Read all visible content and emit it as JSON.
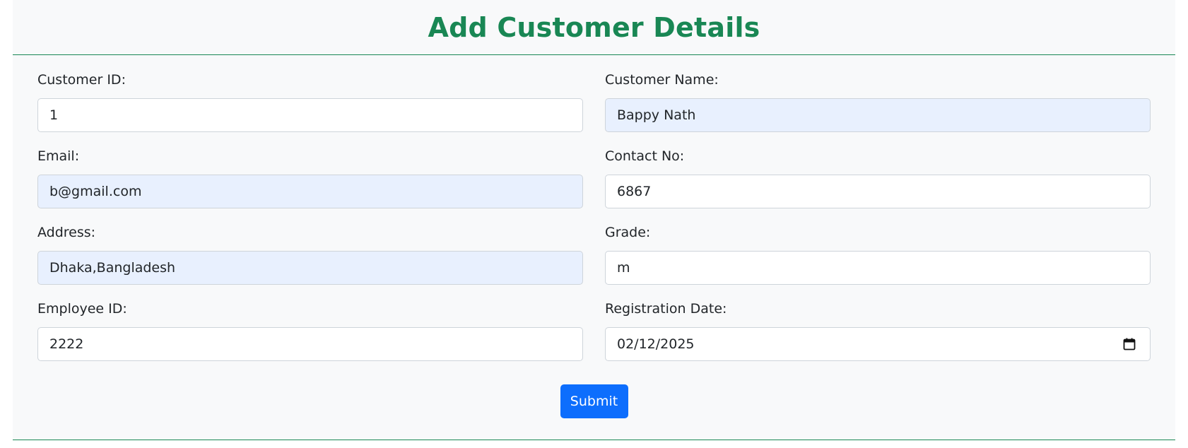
{
  "page": {
    "title": "Add Customer Details"
  },
  "form": {
    "customer_id": {
      "label": "Customer ID:",
      "value": "1"
    },
    "customer_name": {
      "label": "Customer Name:",
      "value": "Bappy Nath"
    },
    "email": {
      "label": "Email:",
      "value": "b@gmail.com"
    },
    "contact_no": {
      "label": "Contact No:",
      "value": "6867"
    },
    "address": {
      "label": "Address:",
      "value": "Dhaka,Bangladesh"
    },
    "grade": {
      "label": "Grade:",
      "value": "m"
    },
    "employee_id": {
      "label": "Employee ID:",
      "value": "2222"
    },
    "registration_date": {
      "label": "Registration Date:",
      "value": "02/12/2025",
      "icon": "calendar-icon"
    },
    "submit_label": "Submit"
  },
  "colors": {
    "accent_green": "#198754",
    "primary_blue": "#0d6efd",
    "autofill_bg": "#e8f0fe",
    "panel_bg": "#f8f9fa"
  }
}
